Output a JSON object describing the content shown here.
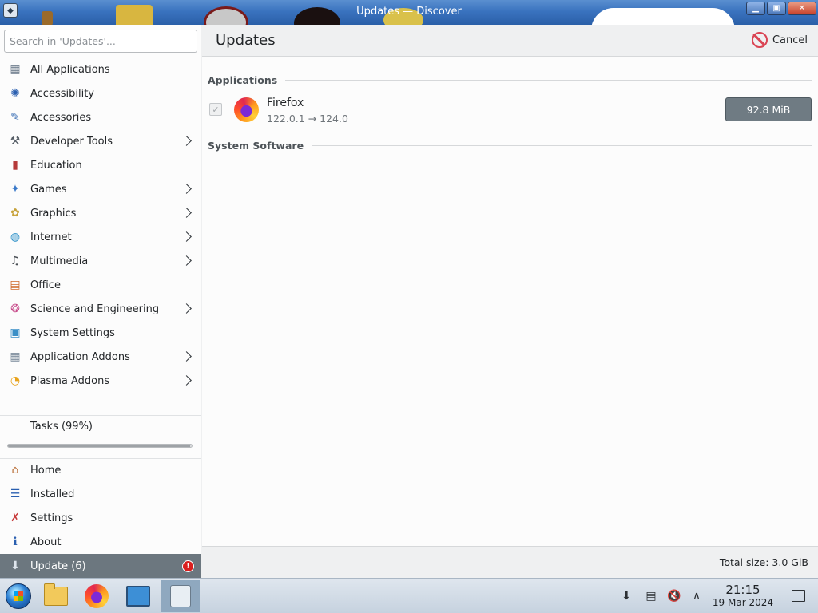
{
  "window": {
    "title": "Updates — Discover",
    "minimize_glyph": "▁",
    "maximize_glyph": "▣",
    "close_glyph": "✕",
    "menu_glyph": "◆"
  },
  "search": {
    "placeholder": "Search in 'Updates'..."
  },
  "categories": [
    {
      "label": "All Applications",
      "icon": "grid-icon",
      "glyph": "▦",
      "color": "#6b7a8a",
      "has_submenu": false
    },
    {
      "label": "Accessibility",
      "icon": "accessibility-icon",
      "glyph": "✺",
      "color": "#2a5fb0",
      "has_submenu": false
    },
    {
      "label": "Accessories",
      "icon": "accessories-icon",
      "glyph": "✎",
      "color": "#3a6fb5",
      "has_submenu": false
    },
    {
      "label": "Developer Tools",
      "icon": "developer-tools-icon",
      "glyph": "⚒",
      "color": "#555d66",
      "has_submenu": true
    },
    {
      "label": "Education",
      "icon": "education-icon",
      "glyph": "▮",
      "color": "#b53a3a",
      "has_submenu": false
    },
    {
      "label": "Games",
      "icon": "games-icon",
      "glyph": "✦",
      "color": "#3a79c9",
      "has_submenu": true
    },
    {
      "label": "Graphics",
      "icon": "graphics-icon",
      "glyph": "✿",
      "color": "#c7a23a",
      "has_submenu": true
    },
    {
      "label": "Internet",
      "icon": "internet-icon",
      "glyph": "◍",
      "color": "#2a8fc7",
      "has_submenu": true
    },
    {
      "label": "Multimedia",
      "icon": "multimedia-icon",
      "glyph": "♫",
      "color": "#4a4f55",
      "has_submenu": true
    },
    {
      "label": "Office",
      "icon": "office-icon",
      "glyph": "▤",
      "color": "#d06a2a",
      "has_submenu": false
    },
    {
      "label": "Science and Engineering",
      "icon": "science-icon",
      "glyph": "❂",
      "color": "#c74a8a",
      "has_submenu": true
    },
    {
      "label": "System Settings",
      "icon": "system-settings-icon",
      "glyph": "▣",
      "color": "#3a8fc7",
      "has_submenu": false
    },
    {
      "label": "Application Addons",
      "icon": "application-addons-icon",
      "glyph": "▦",
      "color": "#7a8a9a",
      "has_submenu": true
    },
    {
      "label": "Plasma Addons",
      "icon": "plasma-addons-icon",
      "glyph": "◔",
      "color": "#e8a21a",
      "has_submenu": true
    }
  ],
  "tasks": {
    "label": "Tasks (99%)",
    "progress": 0.99
  },
  "nav": [
    {
      "label": "Home",
      "icon": "home-icon",
      "glyph": "⌂",
      "color": "#b5652a",
      "active": false,
      "badge": ""
    },
    {
      "label": "Installed",
      "icon": "installed-list-icon",
      "glyph": "☰",
      "color": "#2a5fb0",
      "active": false,
      "badge": ""
    },
    {
      "label": "Settings",
      "icon": "settings-tools-icon",
      "glyph": "✗",
      "color": "#c73a3a",
      "active": false,
      "badge": ""
    },
    {
      "label": "About",
      "icon": "info-icon",
      "glyph": "ℹ",
      "color": "#2a5fb0",
      "active": false,
      "badge": ""
    },
    {
      "label": "Update (6)",
      "icon": "update-icon",
      "glyph": "⬇",
      "color": "#dfe6ee",
      "active": true,
      "badge": "!"
    }
  ],
  "main": {
    "title": "Updates",
    "cancel_label": "Cancel",
    "section_applications": "Applications",
    "section_system": "System Software",
    "updates": [
      {
        "name": "Firefox",
        "version": "122.0.1 → 124.0",
        "size": "92.8 MiB",
        "checked": true,
        "checkmark": "✓"
      }
    ],
    "total_size": "Total size: 3.0 GiB"
  },
  "taskbar": {
    "time": "21:15",
    "date": "19 Mar 2024",
    "tray_discover_glyph": "⬇",
    "tray_clipboard_glyph": "▤",
    "tray_volume_glyph": "🔇",
    "tray_expand_glyph": "∧"
  }
}
